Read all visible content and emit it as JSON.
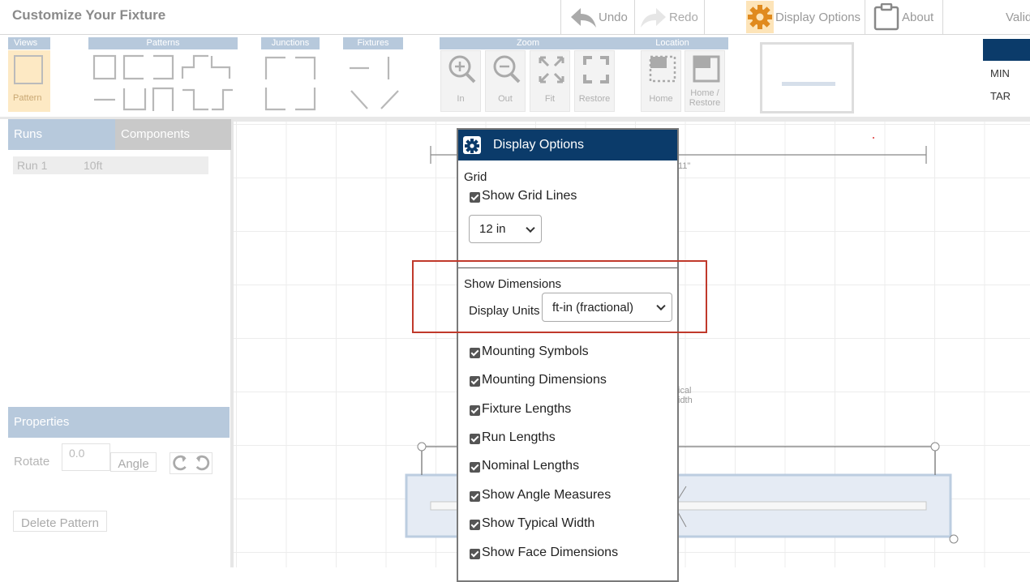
{
  "header": {
    "title": "Customize Your Fixture",
    "undo": "Undo",
    "redo": "Redo",
    "display_options": "Display Options",
    "about": "About",
    "validate": "Valid"
  },
  "toolbar": {
    "views": "Views",
    "views_button": "Pattern",
    "patterns": "Patterns",
    "junctions": "Junctions",
    "fixtures": "Fixtures",
    "zoom": "Zoom",
    "location": "Location",
    "zoom_in": "In",
    "zoom_out": "Out",
    "zoom_fit": "Fit",
    "zoom_restore": "Restore",
    "home": "Home",
    "home_restore_1": "Home /",
    "home_restore_2": "Restore",
    "right_min": "MIN",
    "right_tar": "TAR"
  },
  "left_panel": {
    "tab_runs": "Runs",
    "tab_components": "Components",
    "runs": [
      {
        "name": "Run 1",
        "length": "10ft"
      }
    ],
    "properties": "Properties",
    "rotate_label": "Rotate",
    "rotate_value": "0.0",
    "angle_button": "Angle",
    "delete_button": "Delete Pattern"
  },
  "canvas": {
    "dim_fragment": "11\"",
    "typical_1": "ical",
    "typical_2": "idth"
  },
  "dialog": {
    "title": "Display Options",
    "grid_heading": "Grid",
    "show_grid_lines": "Show Grid Lines",
    "grid_size": "12 in",
    "show_dimensions": "Show Dimensions",
    "display_units_label": "Display Units",
    "display_units_value": "ft-in (fractional)",
    "options": [
      "Mounting Symbols",
      "Mounting Dimensions",
      "Fixture Lengths",
      "Run Lengths",
      "Nominal Lengths",
      "Show Angle Measures",
      "Show Typical Width",
      "Show Face Dimensions"
    ]
  },
  "colors": {
    "dialog_header": "#0b3b6a",
    "panel_header": "#b7c9dc",
    "highlight": "#c0392b",
    "views_active": "#fde9c4"
  }
}
